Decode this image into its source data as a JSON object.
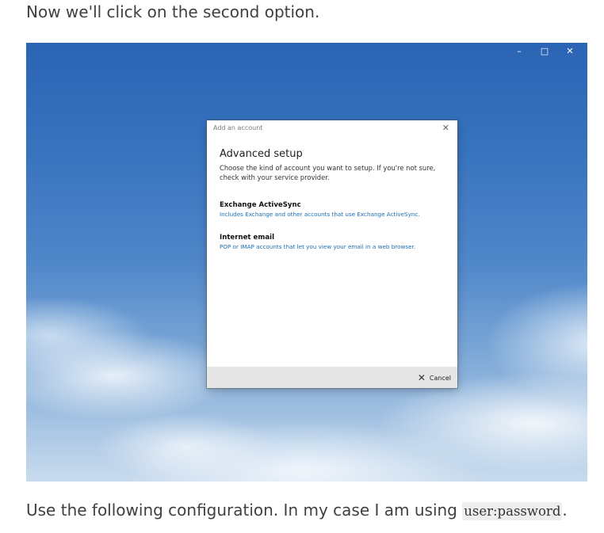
{
  "article": {
    "intro_text": "Now we'll click on the second option.",
    "outro_before": "Use the following configuration. In my case I am using ",
    "outro_code": "user:password",
    "outro_after": "."
  },
  "window_controls": {
    "minimize": "–",
    "maximize": "□",
    "close": "✕"
  },
  "dialog": {
    "title": "Add an account",
    "close_glyph": "✕",
    "heading": "Advanced setup",
    "description": "Choose the kind of account you want to setup. If you're not sure, check with your service provider.",
    "options": [
      {
        "title": "Exchange ActiveSync",
        "subtitle": "Includes Exchange and other accounts that use Exchange ActiveSync."
      },
      {
        "title": "Internet email",
        "subtitle": "POP or IMAP accounts that let you view your email in a web browser."
      }
    ],
    "cancel_label": "Cancel",
    "cancel_glyph": "✕"
  },
  "colors": {
    "link_blue": "#1a6fb5",
    "footer_gray": "#e6e6e6",
    "sky_blue": "#3873be"
  },
  "icons": {
    "dialog_close": "close-icon",
    "cancel": "close-icon"
  }
}
